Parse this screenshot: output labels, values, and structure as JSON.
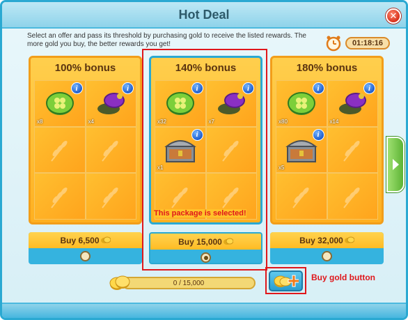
{
  "window": {
    "title": "Hot Deal"
  },
  "description": "Select an offer and pass its threshold by purchasing gold to receive the listed rewards. The more gold you buy, the better rewards you get!",
  "timer": "01:18:16",
  "packages": [
    {
      "title": "100% bonus",
      "rewards": [
        {
          "icon": "clover-coin-icon",
          "qty": "x8"
        },
        {
          "icon": "turtle-bag-icon",
          "qty": "x4"
        }
      ],
      "buy_label": "Buy 6,500",
      "selected": false
    },
    {
      "title": "140% bonus",
      "rewards": [
        {
          "icon": "clover-coin-icon",
          "qty": "x32"
        },
        {
          "icon": "turtle-bag-icon",
          "qty": "x7"
        },
        {
          "icon": "treasure-chest-icon",
          "qty": "x1"
        }
      ],
      "buy_label": "Buy 15,000",
      "selected": true
    },
    {
      "title": "180% bonus",
      "rewards": [
        {
          "icon": "clover-coin-icon",
          "qty": "x80"
        },
        {
          "icon": "turtle-bag-icon",
          "qty": "x14"
        },
        {
          "icon": "treasure-chest-icon",
          "qty": "x5"
        }
      ],
      "buy_label": "Buy 32,000",
      "selected": false
    }
  ],
  "progress": {
    "text": "0 / 15,000",
    "value": 0
  },
  "annotations": {
    "selected": "This package is selected!",
    "buy_gold": "Buy gold button"
  },
  "colors": {
    "accent": "#2aa9d2",
    "package": "#ffb020",
    "annotation": "#e0171b"
  }
}
